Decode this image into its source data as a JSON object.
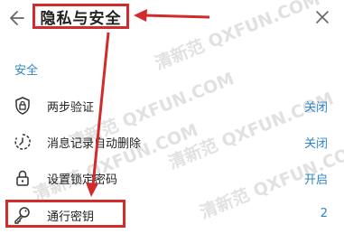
{
  "header": {
    "title": "隐私与安全"
  },
  "section": {
    "label": "安全"
  },
  "rows": [
    {
      "label": "两步验证",
      "value": "关闭"
    },
    {
      "label": "消息记录自动删除",
      "value": "关闭"
    },
    {
      "label": "设置锁定密码",
      "value": "开启"
    },
    {
      "label": "通行密钥",
      "value": "2"
    }
  ],
  "watermarks": [
    "清新范 QXFUN.COM",
    "清新范 QXFUN.COM",
    "清新范 QXFUN.COM",
    "清新范 QXFUN.COM",
    "清新范 QXFUN.COM"
  ],
  "colors": {
    "accent": "#2f86c6",
    "highlight": "#d22b2b"
  }
}
